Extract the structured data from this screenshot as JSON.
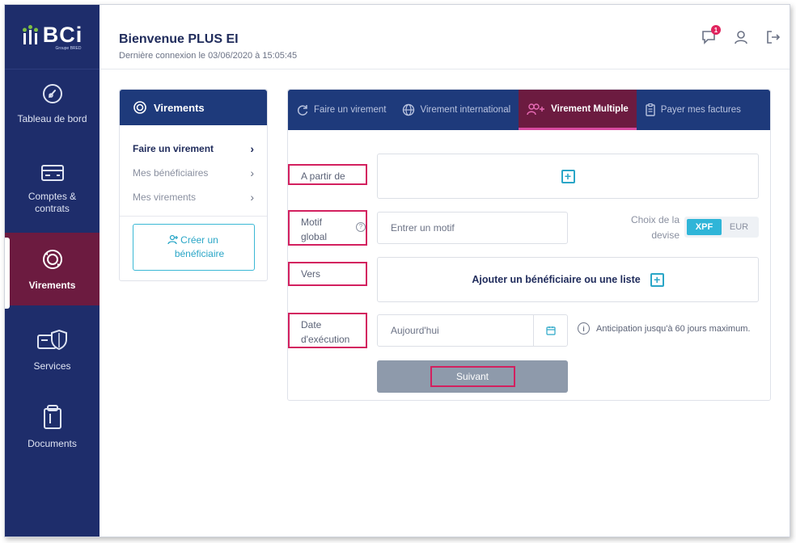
{
  "app": {
    "logo_text": "BCi",
    "logo_subtext": "Groupe BRED"
  },
  "sidebar": {
    "items": [
      {
        "label": "Tableau de bord",
        "icon": "dashboard-gauge-icon"
      },
      {
        "label": "Comptes & contrats",
        "icon": "card-icon"
      },
      {
        "label": "Virements",
        "icon": "transfer-cycle-icon"
      },
      {
        "label": "Services",
        "icon": "shield-card-icon"
      },
      {
        "label": "Documents",
        "icon": "clipboard-icon"
      }
    ],
    "active_index": 2
  },
  "header": {
    "welcome": "Bienvenue PLUS EI",
    "last_login": "Dernière connexion le 03/06/2020 à 15:05:45",
    "notification_count": "1",
    "icons": [
      "chat-notification-icon",
      "user-icon",
      "logout-icon"
    ]
  },
  "left_panel": {
    "title": "Virements",
    "items": [
      {
        "label": "Faire un virement"
      },
      {
        "label": "Mes bénéficiaires"
      },
      {
        "label": "Mes virements"
      }
    ],
    "create_button": "Créer un bénéficiaire"
  },
  "tabs": [
    {
      "label": "Faire un virement",
      "icon": "refresh-icon"
    },
    {
      "label": "Virement international",
      "icon": "globe-icon"
    },
    {
      "label": "Virement Multiple",
      "icon": "users-add-icon"
    },
    {
      "label": "Payer mes factures",
      "icon": "receipt-icon"
    }
  ],
  "active_tab": 2,
  "form": {
    "from_label": "A partir de",
    "motif_label": "Motif global",
    "motif_placeholder": "Entrer un motif",
    "to_label": "Vers",
    "to_action": "Ajouter un bénéficiaire ou une liste",
    "date_label": "Date d'exécution",
    "date_value": "Aujourd'hui",
    "devise_label": "Choix de la devise",
    "devise_options": [
      "XPF",
      "EUR"
    ],
    "devise_selected": "XPF",
    "info_text": "Anticipation jusqu'à 60 jours maximum.",
    "next_button": "Suivant"
  },
  "colors": {
    "sidebar_bg": "#1e2d6b",
    "active_bg": "#6c1b40",
    "tab_bar_bg": "#1e3a7b",
    "accent_cyan": "#2fb5d8",
    "highlight_red": "#d3205f"
  }
}
